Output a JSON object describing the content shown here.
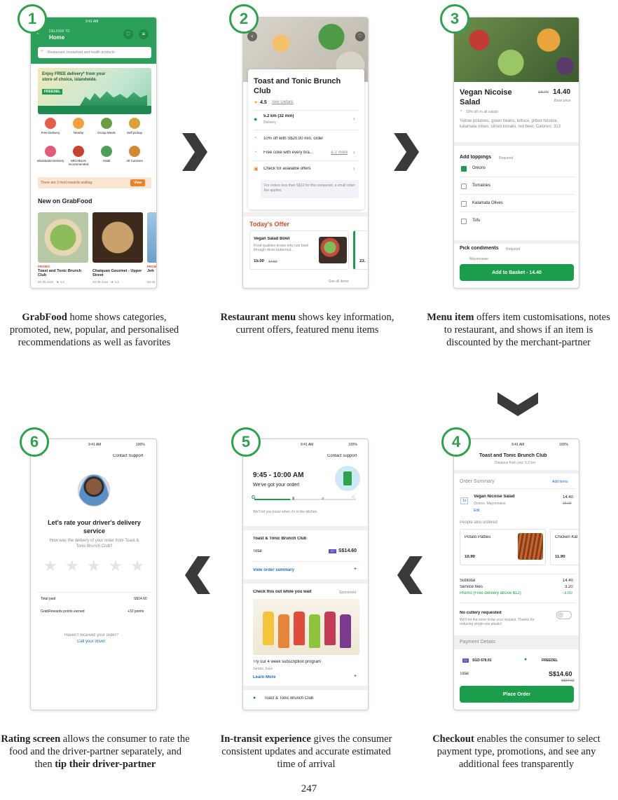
{
  "page_number": "247",
  "colors": {
    "brand_green": "#1b9e4b",
    "arrow": "#3a3a3a",
    "badge": "#2ca24b"
  },
  "steps": [
    {
      "num": "1",
      "bold": "GrabFood",
      "text": " home shows categories, promoted, new, popular, and personalised recommendations as well as favorites"
    },
    {
      "num": "2",
      "bold": "Restaurant menu",
      "text": " shows key information, current offers, featured menu items"
    },
    {
      "num": "3",
      "bold": "Menu item",
      "text": " offers item customisations, notes to restaurant, and shows if an item is discounted by the merchant-partner"
    },
    {
      "num": "4",
      "bold": "Checkout",
      "text": " enables the consumer to select payment type, promotions, and see any additional fees transparently"
    },
    {
      "num": "5",
      "bold": "In-transit experience",
      "text": " gives the consumer consistent updates and accurate estimated time of arrival"
    },
    {
      "num": "6",
      "bold": "Rating screen",
      "text": " allows the consumer to rate the food and the driver-partner separately, and then ",
      "bold2": "tip their driver-partner"
    }
  ],
  "screen1": {
    "time": "9:41 AM",
    "deliver_to": "DELIVER TO",
    "location": "Home",
    "search_placeholder": "Restaurant, household and health products",
    "banner_text": "Enjoy FREE delivery* from your store of choice, islandwide.",
    "banner_code": "FREEDEL",
    "categories": [
      "Free Delivery",
      "Nearby",
      "Group Meals",
      "Self pickup",
      "Islandwide Delivery",
      "MICHELIN recommended",
      "Halal",
      "All Cuisines"
    ],
    "rewards_text": "There are 3 food rewards waiting.",
    "rewards_btn": "View",
    "section_title": "New on GrabFood",
    "cards": [
      {
        "promo": "PROMO",
        "name": "Toast and Tonic Brunch Club",
        "meta": "20-35 mins · ★ 4.5"
      },
      {
        "promo": "",
        "name": "Chaiquan Gourmet - Upper Street",
        "meta": "20-35 mins · ★ 4.2"
      },
      {
        "promo": "PROMO",
        "name": "Joh",
        "meta": "20-45"
      }
    ]
  },
  "screen2": {
    "name": "Toast and Tonic Brunch Club",
    "rating": "4.5",
    "see_details": "See Details",
    "distance": "5.2 km (32 min)",
    "distance_sub": "Delivery",
    "offer1": "10% off with S$20.00 min. order",
    "offer2": "Free coke with every bra...",
    "offer2_more": "& 2 more",
    "offer3": "Check for available offers",
    "note": "For orders less than S$12 for this restaurant, a small order fee applies.",
    "todays_offer": "Today's Offer",
    "item_name": "Vegan Salad Bowl",
    "item_desc": "Food qualities braise tofu cuts bowl through slices buttermut...",
    "item_price": "15.00",
    "item_old": "17.50",
    "item2_price": "23.",
    "see_all": "See all items"
  },
  "screen3": {
    "name": "Vegan Nicoise Salad",
    "old_price": "16.00",
    "price": "14.40",
    "base_price": "Base price",
    "discount": "10% off on all salads",
    "desc": "Yellow potatoes, green beans, lettuce, pitted Nicoise, kalamata olives, sliced tomato, red beet. Calories: 313",
    "toppings_title": "Add toppings",
    "required": "Required",
    "toppings": [
      "Onions",
      "Tomatoes",
      "Kalamata Olives",
      "Tofu"
    ],
    "condiments_title": "Pick condiments",
    "condiment_peek": "Mayonnaise",
    "add_btn": "Add to Basket - 14.40"
  },
  "screen4": {
    "time": "9:41 AM",
    "battery": "100%",
    "title": "Toast and Tonic Brunch Club",
    "subtitle": "Distance from you: 5.2 km",
    "order_summary": "Order Summary",
    "add_items": "Add Items",
    "qty": "1x",
    "item": "Vegan Nicoise Salad",
    "item_opts": "Onions, Mayonnaise",
    "item_price": "14.40",
    "item_old": "16.00",
    "edit": "Edit",
    "also_ordered": "People also ordered",
    "rec1": "Potato Patties",
    "rec1_price": "10.90",
    "rec2": "Chicken Kat",
    "rec2_price": "11.90",
    "subtotal_l": "Subtotal",
    "subtotal": "14.40",
    "service_l": "Service fees",
    "service": "3.20",
    "promo_l": "Promo (Free delivery above $12)",
    "promo": "-3.00",
    "cutlery": "No cutlery requested",
    "cutlery_sub": "We'll let the store know your request. Thanks for reducing single-use plastic!",
    "payment": "Payment Details",
    "card": "SGD 678.91",
    "promo_code": "FREEDEL",
    "total_l": "Total",
    "total": "S$14.60",
    "total_old": "S$17.60",
    "place_order": "Place Order"
  },
  "screen5": {
    "time": "9:41 AM",
    "battery": "100%",
    "support": "Contact support",
    "eta": "9:45 - 10:00 AM",
    "status": "We've got your order!",
    "status_sub": "We'll let you know when it's in the kitchen.",
    "restaurant": "Toast & Tonic Brunch Club",
    "total_l": "Total",
    "total": "S$14.60",
    "view_summary": "View order summary",
    "promo_title": "Check this out while you wait",
    "sponsored": "Sponsored",
    "promo_text": "Try our 4 week subscription program",
    "promo_brand": "Jumbo Juice",
    "learn_more": "Learn More",
    "footer": "Toast & Tonic Brunch Club"
  },
  "screen6": {
    "time": "9:41 AM",
    "battery": "100%",
    "support": "Contact Support",
    "title": "Let's rate your driver's delivery service",
    "question": "How was the delivery of your order from Toast & Tonic Brunch Club?",
    "stars": 5,
    "total_paid_l": "Total paid",
    "total_paid": "S$14.60",
    "points_l": "GrabRewards points earned",
    "points": "+32 points",
    "not_received": "Haven't received your order?",
    "call": "Call your driver"
  }
}
